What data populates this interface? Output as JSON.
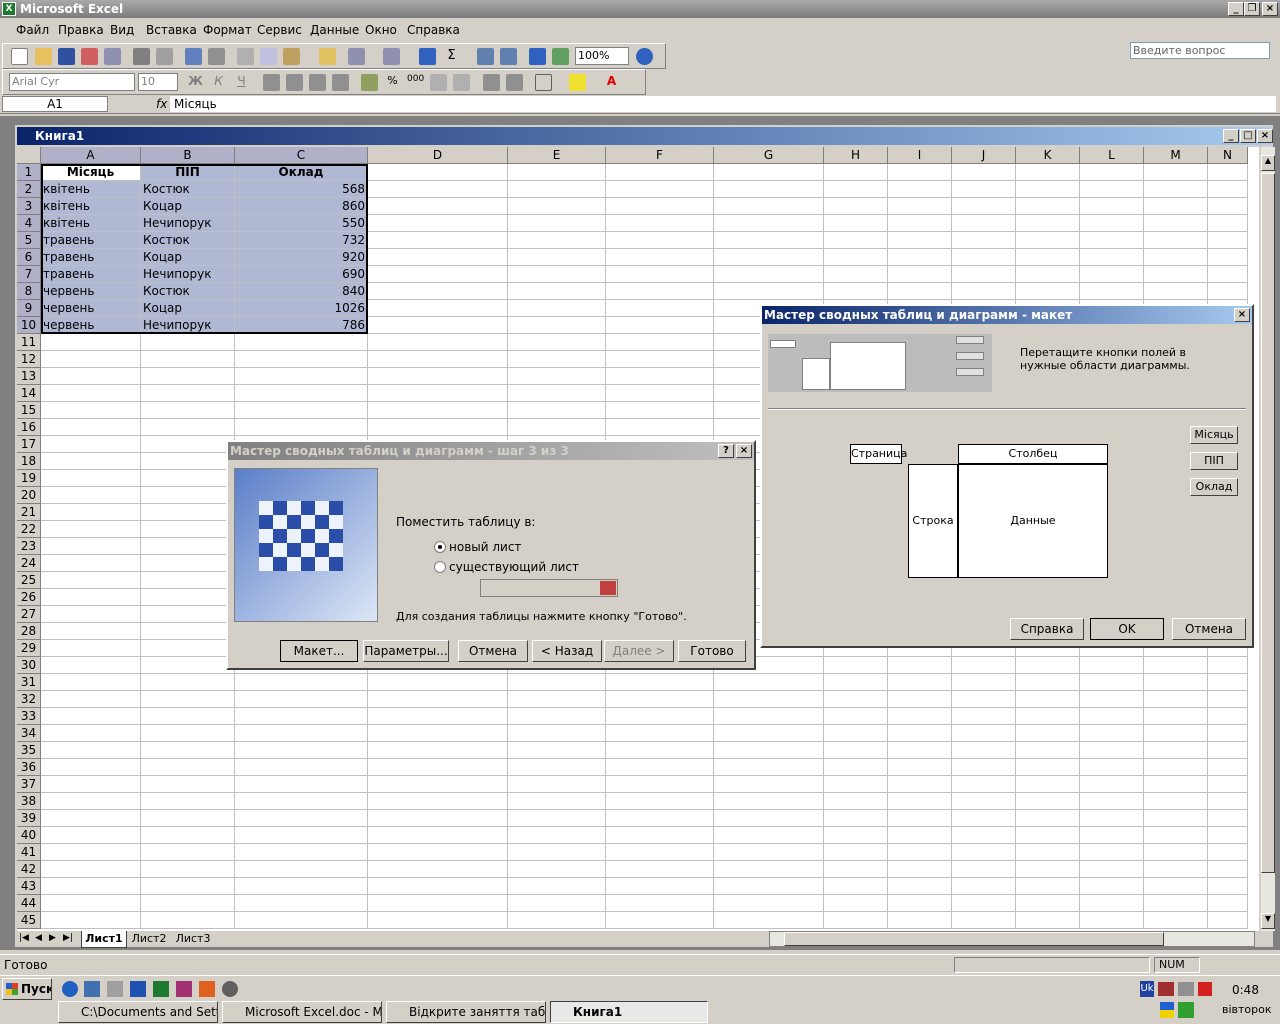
{
  "app": {
    "title": "Microsoft Excel"
  },
  "menu": [
    "Файл",
    "Правка",
    "Вид",
    "Вставка",
    "Формат",
    "Сервис",
    "Данные",
    "Окно",
    "Справка"
  ],
  "ask_placeholder": "Введите вопрос",
  "toolbar": {
    "zoom": "100%",
    "font": "Arial Cyr",
    "size": "10"
  },
  "formula": {
    "cell": "A1",
    "fx": "fx",
    "value": "Місяць"
  },
  "workbook": {
    "title": "Книга1"
  },
  "columns": [
    "A",
    "B",
    "C",
    "D",
    "E",
    "F",
    "G",
    "H",
    "I",
    "J",
    "K",
    "L",
    "M",
    "N"
  ],
  "rows": [
    "1",
    "2",
    "3",
    "4",
    "5",
    "6",
    "7",
    "8",
    "9",
    "10",
    "11",
    "12",
    "13",
    "14",
    "15",
    "16",
    "17",
    "18",
    "19",
    "20",
    "21",
    "22",
    "23",
    "24",
    "25",
    "26",
    "27",
    "28",
    "29",
    "30",
    "31",
    "32",
    "33",
    "34",
    "35",
    "36",
    "37",
    "38",
    "39",
    "40",
    "41",
    "42",
    "43",
    "44",
    "45"
  ],
  "table": {
    "headers": [
      "Місяць",
      "ПІП",
      "Оклад"
    ],
    "rows": [
      [
        "квітень",
        "Костюк",
        "568"
      ],
      [
        "квітень",
        "Коцар",
        "860"
      ],
      [
        "квітень",
        "Нечипорук",
        "550"
      ],
      [
        "травень",
        "Костюк",
        "732"
      ],
      [
        "травень",
        "Коцар",
        "920"
      ],
      [
        "травень",
        "Нечипорук",
        "690"
      ],
      [
        "червень",
        "Костюк",
        "840"
      ],
      [
        "червень",
        "Коцар",
        "1026"
      ],
      [
        "червень",
        "Нечипорук",
        "786"
      ]
    ]
  },
  "sheets": [
    "Лист1",
    "Лист2",
    "Лист3"
  ],
  "status": {
    "left": "Готово",
    "num": "NUM"
  },
  "wizard": {
    "title": "Мастер сводных таблиц и диаграмм - шаг 3 из 3",
    "place_label": "Поместить таблицу в:",
    "opt_new": "новый лист",
    "opt_existing": "существующий лист",
    "hint": "Для создания таблицы нажмите кнопку \"Готово\".",
    "buttons": [
      "Макет...",
      "Параметры...",
      "Отмена",
      "< Назад",
      "Далее >",
      "Готово"
    ]
  },
  "layout": {
    "title": "Мастер сводных таблиц и диаграмм - макет",
    "instruction": "Перетащите кнопки полей в нужные области диаграммы.",
    "page": "Страница",
    "column": "Столбец",
    "row": "Строка",
    "data": "Данные",
    "fields": [
      "Місяць",
      "ПІП",
      "Оклад"
    ],
    "buttons": {
      "help": "Справка",
      "ok": "OK",
      "cancel": "Отмена"
    }
  },
  "taskbar": {
    "start": "Пуск",
    "items": [
      "C:\\Documents and Settin...",
      "Microsoft Excel.doc - Mic...",
      "Відкрите заняття табл....",
      "Книга1"
    ],
    "lang": "Uk",
    "time": "0:48",
    "day": "вівторок"
  }
}
